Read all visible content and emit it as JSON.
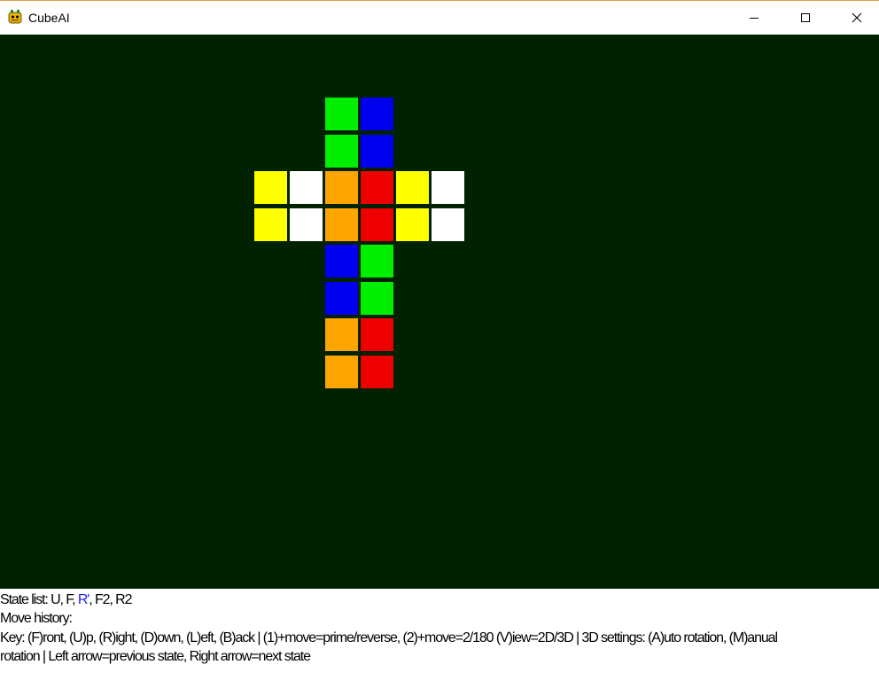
{
  "window": {
    "title": "CubeAI",
    "minimize_icon": "minimize-icon",
    "maximize_icon": "maximize-icon",
    "close_icon": "close-icon"
  },
  "colors": {
    "green": "#00ee00",
    "blue": "#0000ee",
    "yellow": "#ffff00",
    "white": "#ffffff",
    "orange": "#ffa500",
    "red": "#ee0000",
    "canvas_bg": "#002200",
    "highlight": "#1c1cff"
  },
  "cube_net": {
    "up": [
      [
        "green",
        "blue"
      ],
      [
        "green",
        "blue"
      ]
    ],
    "left": [
      [
        "yellow",
        "white"
      ],
      [
        "yellow",
        "white"
      ]
    ],
    "front": [
      [
        "orange",
        "red"
      ],
      [
        "orange",
        "red"
      ]
    ],
    "right": [
      [
        "yellow",
        "white"
      ],
      [
        "yellow",
        "white"
      ]
    ],
    "down": [
      [
        "blue",
        "green"
      ],
      [
        "blue",
        "green"
      ]
    ],
    "back": [
      [
        "orange",
        "red"
      ],
      [
        "orange",
        "red"
      ]
    ]
  },
  "status": {
    "state_list_prefix": "State list: ",
    "states": [
      "U",
      "F",
      "R'",
      "F2",
      "R2"
    ],
    "current_state_index": 2,
    "move_history_label": "Move history:",
    "key_line_1": "Key: (F)ront, (U)p, (R)ight, (D)own, (L)eft, (B)ack | (1)+move=prime/reverse, (2)+move=2/180      (V)iew=2D/3D | 3D settings: (A)uto rotation, (M)anual",
    "key_line_2": "rotation | Left arrow=previous state, Right arrow=next state"
  }
}
